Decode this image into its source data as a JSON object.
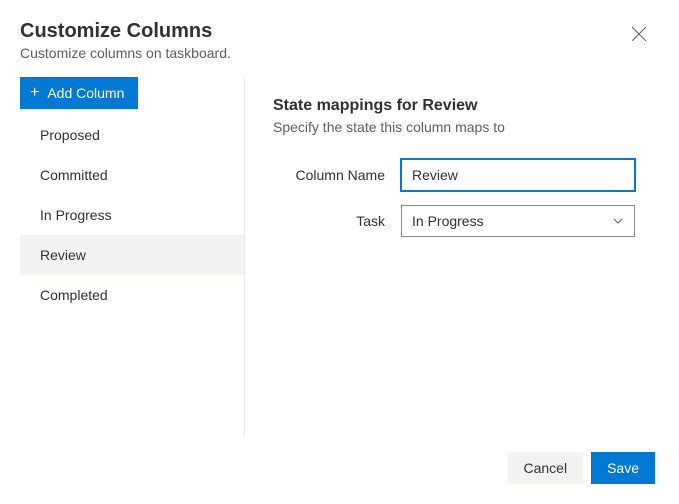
{
  "header": {
    "title": "Customize Columns",
    "subtitle": "Customize columns on taskboard."
  },
  "sidebar": {
    "add_label": "Add Column",
    "items": [
      {
        "label": "Proposed",
        "selected": false
      },
      {
        "label": "Committed",
        "selected": false
      },
      {
        "label": "In Progress",
        "selected": false
      },
      {
        "label": "Review",
        "selected": true
      },
      {
        "label": "Completed",
        "selected": false
      }
    ]
  },
  "main": {
    "section_title": "State mappings for Review",
    "section_desc": "Specify the state this column maps to",
    "column_name_label": "Column Name",
    "column_name_value": "Review",
    "task_label": "Task",
    "task_value": "In Progress"
  },
  "footer": {
    "cancel_label": "Cancel",
    "save_label": "Save"
  }
}
